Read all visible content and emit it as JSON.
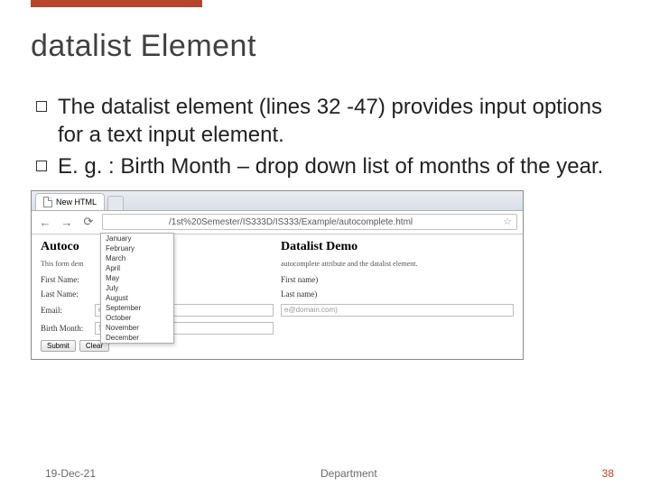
{
  "title": "datalist Element",
  "bullets": [
    "The datalist element (lines 32 -47) provides input options for a text input element.",
    "E. g. : Birth Month – drop down list of months of the year."
  ],
  "browser": {
    "tab_label": "New HTML",
    "url_right": "/1st%20Semester/IS333D/IS333/Example/autocomplete.html"
  },
  "form_left": {
    "heading": "Autoco",
    "desc": "This form dem",
    "first_name_label": "First Name:",
    "last_name_label": "Last Name:",
    "email_label": "Email:",
    "email_value": "name",
    "birth_month_label": "Birth Month:",
    "birth_month_placeholder": "Select a month",
    "submit": "Submit",
    "clear": "Clear"
  },
  "form_right": {
    "heading": "Datalist Demo",
    "desc": "autocomplete attribute and the datalist element.",
    "first_name_label": "First name)",
    "last_name_label": "Last name)",
    "email_placeholder": "e@domain.com)"
  },
  "dropdown_options": [
    "January",
    "February",
    "March",
    "April",
    "May",
    "July",
    "August",
    "September",
    "October",
    "November",
    "December"
  ],
  "footer": {
    "date": "19-Dec-21",
    "center": "Department",
    "page": "38"
  }
}
